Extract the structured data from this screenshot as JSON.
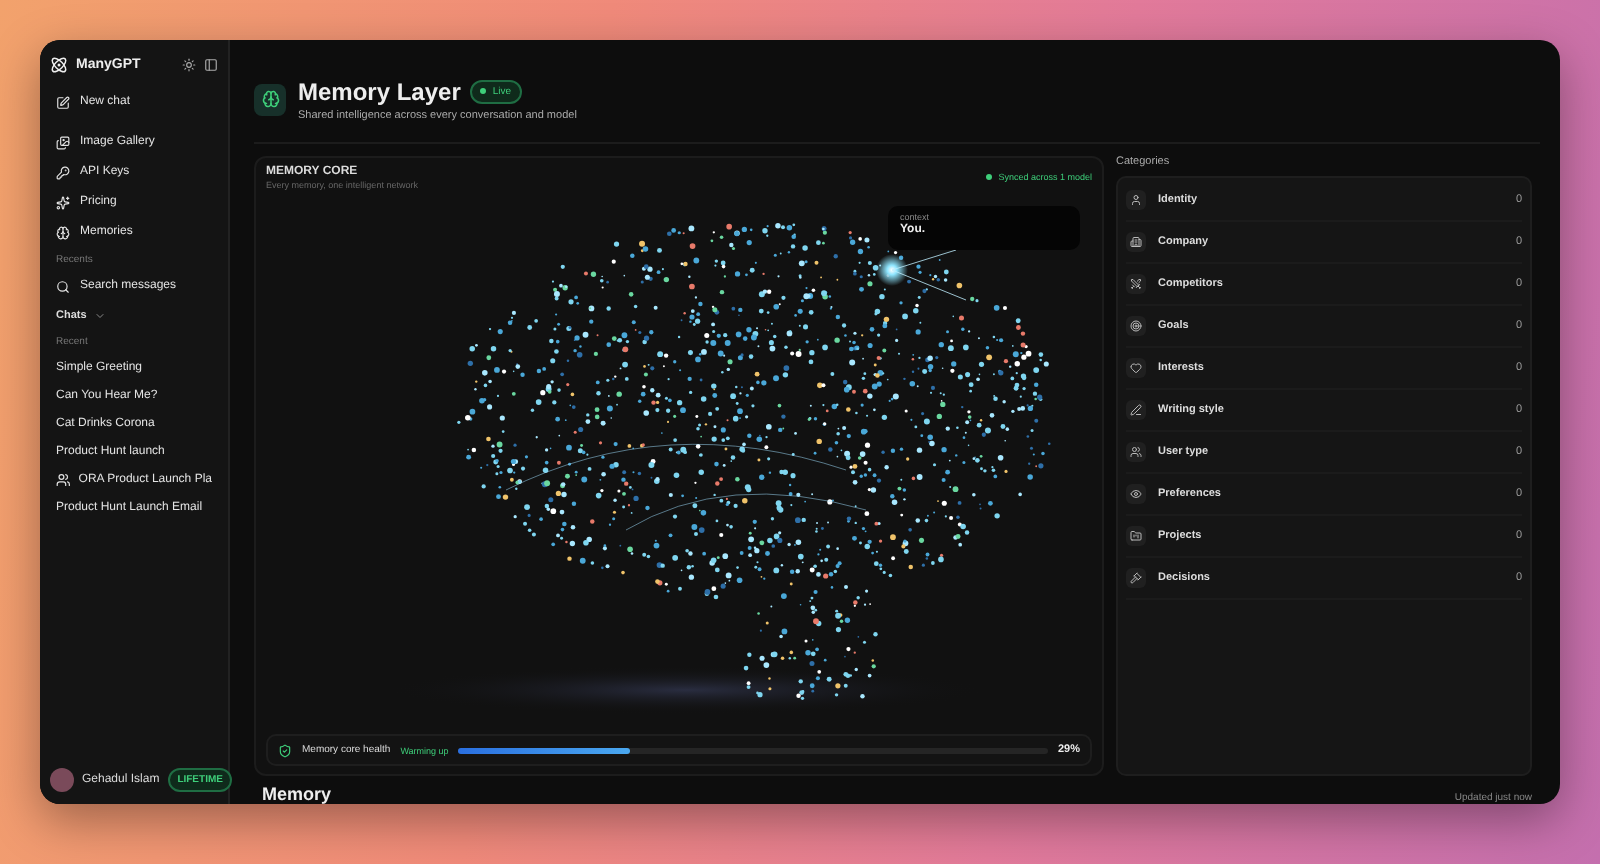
{
  "sidebar": {
    "brand": "ManyGPT",
    "new_chat": "New chat",
    "nav": [
      {
        "label": "Image Gallery"
      },
      {
        "label": "API Keys"
      },
      {
        "label": "Pricing"
      },
      {
        "label": "Memories"
      }
    ],
    "recents_label": "Recents",
    "search": "Search messages",
    "chats_toggle": "Chats",
    "recent_label": "Recent",
    "chats": [
      {
        "label": "Simple Greeting",
        "kind": "chat"
      },
      {
        "label": "Can You Hear Me?",
        "kind": "chat"
      },
      {
        "label": "Cat Drinks Corona",
        "kind": "chat"
      },
      {
        "label": "Product Hunt launch",
        "kind": "chat"
      },
      {
        "label": "ORA Product Launch Pla",
        "kind": "group"
      },
      {
        "label": "Product Hunt Launch Email",
        "kind": "chat"
      }
    ],
    "user": {
      "name": "Gehadul Islam",
      "plan": "LIFETIME"
    }
  },
  "header": {
    "title": "Memory Layer",
    "badge": "Live",
    "subtitle": "Shared intelligence across every conversation and model"
  },
  "memory_core": {
    "title": "MEMORY CORE",
    "subtitle": "Every memory, one intelligent network",
    "sync": "Synced across 1 model",
    "tooltip": {
      "label": "context",
      "value": "You."
    },
    "health": {
      "label": "Memory core health",
      "status": "Warming up",
      "level": 0.29,
      "reading": "29%"
    }
  },
  "categories": {
    "title": "Categories",
    "items": [
      {
        "label": "Identity",
        "count": "0"
      },
      {
        "label": "Company",
        "count": "0"
      },
      {
        "label": "Competitors",
        "count": "0"
      },
      {
        "label": "Goals",
        "count": "0"
      },
      {
        "label": "Interests",
        "count": "0"
      },
      {
        "label": "Writing style",
        "count": "0"
      },
      {
        "label": "User type",
        "count": "0"
      },
      {
        "label": "Preferences",
        "count": "0"
      },
      {
        "label": "Projects",
        "count": "0"
      },
      {
        "label": "Decisions",
        "count": "0"
      }
    ]
  },
  "memory_section": {
    "title": "Memory",
    "updated": "Updated just now"
  }
}
